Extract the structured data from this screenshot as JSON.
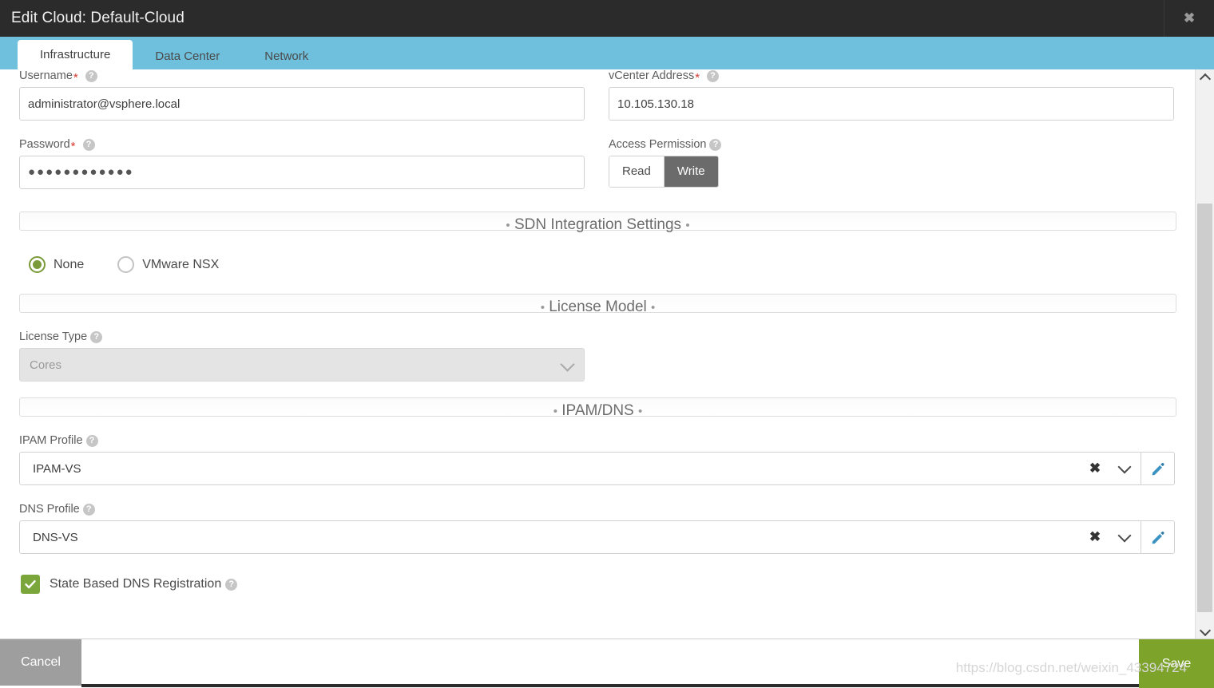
{
  "window": {
    "title": "Edit Cloud: Default-Cloud",
    "close_icon": "close-icon",
    "close_glyph": "✖"
  },
  "tabs": [
    {
      "label": "Infrastructure",
      "active": true
    },
    {
      "label": "Data Center",
      "active": false
    },
    {
      "label": "Network",
      "active": false
    }
  ],
  "form": {
    "username": {
      "label": "Username",
      "required_mark": "*",
      "value": "administrator@vsphere.local",
      "placeholder": "",
      "help_icon": "help-icon",
      "help_glyph": "?"
    },
    "vcenter_address": {
      "label": "vCenter Address",
      "required_mark": "*",
      "value": "10.105.130.18",
      "placeholder": "",
      "help_glyph": "?"
    },
    "password": {
      "label": "Password",
      "required_mark": "*",
      "value": "●●●●●●●●●●●●",
      "placeholder": "",
      "help_glyph": "?"
    },
    "access_permission": {
      "label": "Access Permission",
      "help_glyph": "?",
      "options": [
        "Read",
        "Write"
      ],
      "selected": "Write"
    }
  },
  "sections": {
    "sdn": {
      "title": "SDN Integration Settings",
      "bullet": "•",
      "options": [
        {
          "label": "None",
          "selected": true
        },
        {
          "label": "VMware NSX",
          "selected": false
        }
      ]
    },
    "license": {
      "title": "License Model",
      "bullet": "•",
      "license_type": {
        "label": "License Type",
        "help_glyph": "?",
        "value": "Cores",
        "disabled": true,
        "chevron_icon": "chevron-down-icon"
      }
    },
    "ipam_dns": {
      "title": "IPAM/DNS",
      "bullet": "•",
      "ipam_profile": {
        "label": "IPAM Profile",
        "help_glyph": "?",
        "value": "IPAM-VS",
        "clear_glyph": "✖",
        "clear_icon": "clear-icon",
        "chevron_icon": "chevron-down-icon",
        "edit_icon": "pencil-icon"
      },
      "dns_profile": {
        "label": "DNS Profile",
        "help_glyph": "?",
        "value": "DNS-VS",
        "clear_glyph": "✖",
        "clear_icon": "clear-icon",
        "chevron_icon": "chevron-down-icon",
        "edit_icon": "pencil-icon"
      },
      "state_based_dns": {
        "label": "State Based DNS Registration",
        "help_glyph": "?",
        "checked": true
      }
    }
  },
  "footer": {
    "cancel_label": "Cancel",
    "save_label": "Save"
  },
  "watermark": {
    "text": "https://blog.csdn.net/weixin_43394724"
  },
  "colors": {
    "titlebar": "#2b2b2b",
    "tabstrip": "#6fc0dc",
    "accent_green": "#7da32a",
    "checkbox_green": "#7aa63c",
    "radio_green": "#7a9a3a",
    "toggle_on": "#6b6b6b",
    "cancel_gray": "#9e9e9e",
    "required_red": "#d9362b"
  },
  "scrollbar": {
    "up_icon": "chevron-up-icon",
    "down_icon": "chevron-down-icon"
  }
}
